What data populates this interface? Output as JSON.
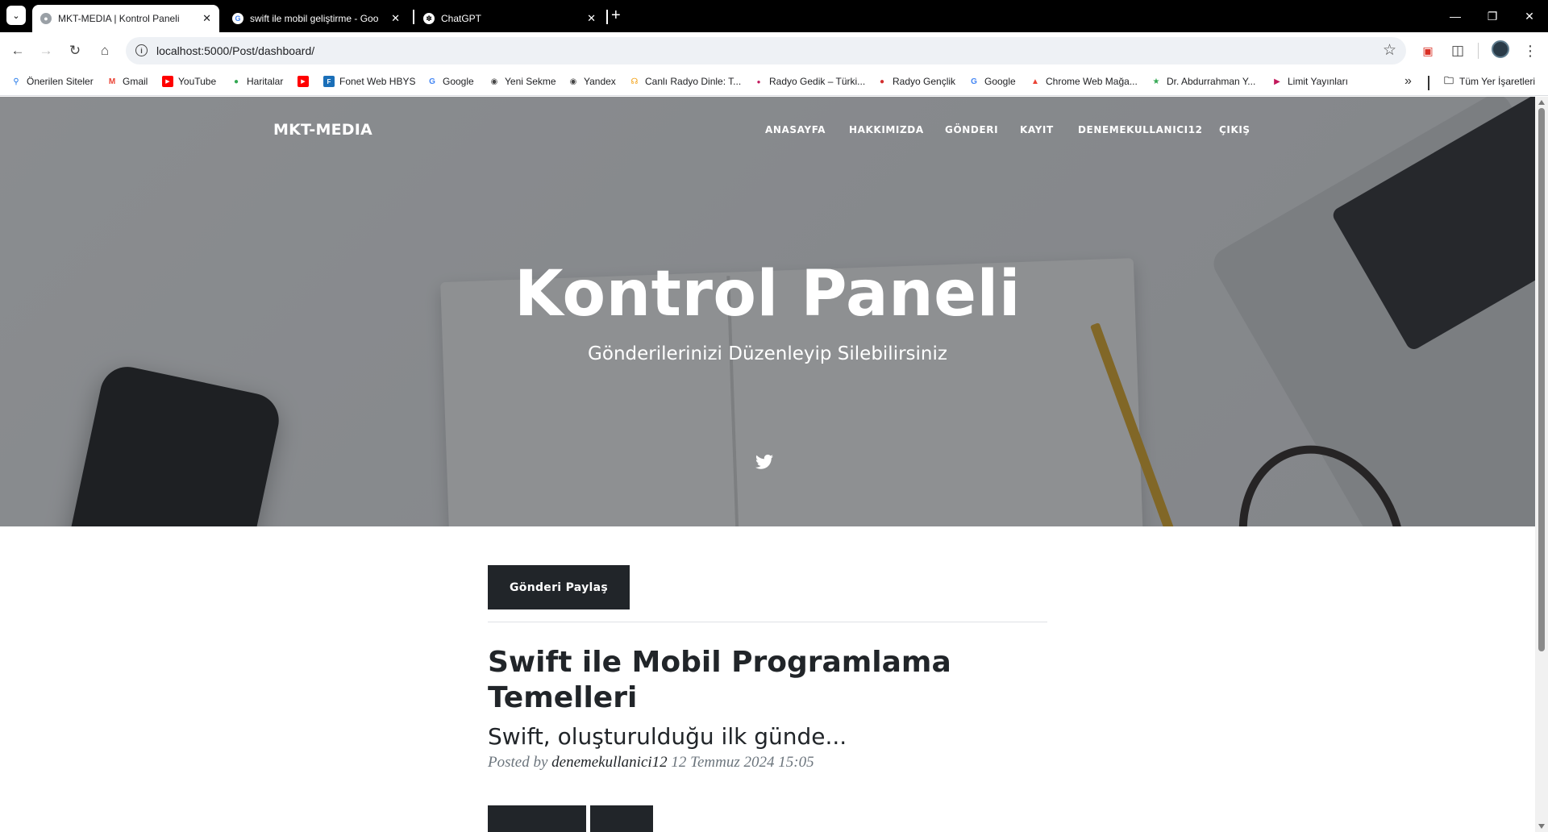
{
  "browser": {
    "tabs": [
      {
        "title": "MKT-MEDIA | Kontrol Paneli",
        "active": true
      },
      {
        "title": "swift ile mobil geliştirme - Goo",
        "active": false
      },
      {
        "title": "ChatGPT",
        "active": false
      }
    ],
    "url": "localhost:5000/Post/dashboard/",
    "bookmarks": [
      {
        "label": "Önerilen Siteler",
        "icon": "search-icon"
      },
      {
        "label": "Gmail",
        "icon": "gmail-icon"
      },
      {
        "label": "YouTube",
        "icon": "youtube-icon"
      },
      {
        "label": "Haritalar",
        "icon": "maps-pin-icon"
      },
      {
        "label": "",
        "icon": "youtube-icon"
      },
      {
        "label": "Fonet Web HBYS",
        "icon": "fonet-icon"
      },
      {
        "label": "Google",
        "icon": "google-icon"
      },
      {
        "label": "Yeni Sekme",
        "icon": "globe-icon"
      },
      {
        "label": "Yandex",
        "icon": "globe-icon"
      },
      {
        "label": "Canlı Radyo Dinle: T...",
        "icon": "headphones-icon"
      },
      {
        "label": "Radyo Gedik – Türki...",
        "icon": "radio-icon"
      },
      {
        "label": "Radyo Gençlik",
        "icon": "radio-icon"
      },
      {
        "label": "Google",
        "icon": "google-icon"
      },
      {
        "label": "Chrome Web Mağa...",
        "icon": "chrome-store-icon"
      },
      {
        "label": "Dr. Abdurrahman Y...",
        "icon": "antenna-icon"
      },
      {
        "label": "Limit Yayınları",
        "icon": "play-icon"
      }
    ],
    "all_bookmarks_label": "Tüm Yer İşaretleri"
  },
  "site": {
    "brand": "MKT-MEDIA",
    "nav": [
      "ANASAYFA",
      "HAKKIMIZDA",
      "GÖNDERI",
      "KAYIT",
      "DENEMEKULLANICI12",
      "ÇIKIŞ"
    ],
    "hero_title": "Kontrol Paneli",
    "hero_subtitle": "Gönderilerinizi Düzenleyip Silebilirsiniz",
    "share_button": "Gönderi Paylaş",
    "post": {
      "title": "Swift ile Mobil Programlama Temelleri",
      "subtitle": "Swift, oluşturulduğu ilk günde...",
      "posted_by": "Posted by",
      "author": "denemekullanici12",
      "date": "12 Temmuz 2024 15:05"
    }
  },
  "colors": {
    "dark": "#212529",
    "muted": "#6c757d",
    "tabstrip": "#000000"
  }
}
